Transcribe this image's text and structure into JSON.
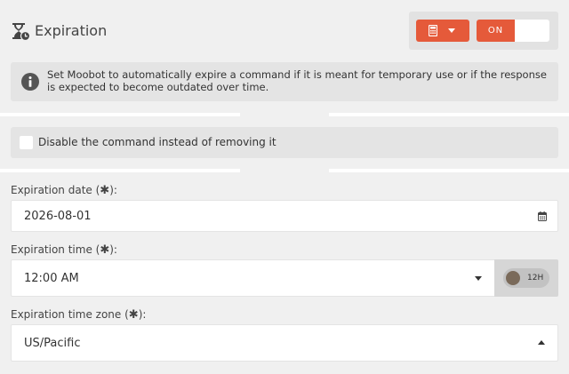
{
  "header": {
    "title": "Expiration",
    "icon": "hourglass-clock-icon",
    "mode_icon": "calculator-icon",
    "toggle_label": "ON",
    "accent_color": "#e55a3a"
  },
  "info": {
    "icon": "info-icon",
    "text": "Set Moobot to automatically expire a command if it is meant for temporary use or if the response is expected to become outdated over time."
  },
  "disable_option": {
    "label": "Disable the command instead of removing it",
    "checked": false
  },
  "fields": {
    "date": {
      "label": "Expiration date (",
      "label_end": "):",
      "value": "2026-08-01",
      "icon": "calendar-icon"
    },
    "time": {
      "label": "Expiration time (",
      "label_end": "):",
      "value": "12:00 AM",
      "format_toggle": "12H"
    },
    "timezone": {
      "label": "Expiration time zone (",
      "label_end": "):",
      "value": "US/Pacific"
    }
  },
  "required_mark": "✱"
}
